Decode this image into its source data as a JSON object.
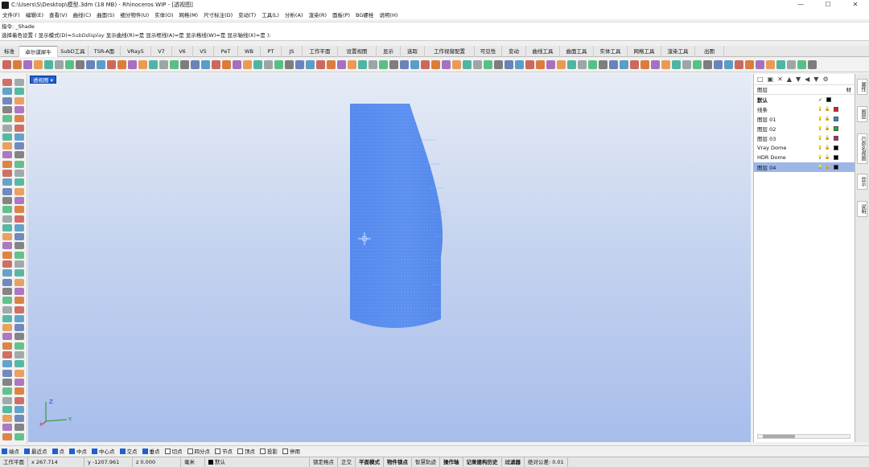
{
  "window": {
    "title": "C:\\Users\\S\\Desktop\\模型.3dm (18 MB) - Rhinoceros WIP - [透视图]",
    "controls": [
      "—",
      "☐",
      "✕"
    ]
  },
  "menu": [
    "文件(F)",
    "编辑(E)",
    "查看(V)",
    "曲线(C)",
    "曲面(S)",
    "细分物件(U)",
    "实体(O)",
    "网格(M)",
    "尺寸标注(D)",
    "变动(T)",
    "工具(L)",
    "分析(A)",
    "渲染(R)",
    "面板(P)",
    "BG螺栓",
    "说明(H)"
  ],
  "command": {
    "line1": "指令: _Shade",
    "line2_prefix": "选择着色设置 ( 显示模式(D)=",
    "line2_mode": "SubDdisplay",
    "line2_rest": " 显示曲线(R)=是  显示框线(A)=是  显示格线(W)=是  显示轴线(X)=是 ):"
  },
  "tabs": [
    "标准",
    "卓尔谟犀牛",
    "SubD工具",
    "TSR-A面",
    "VRay5",
    "V7",
    "V6",
    "V5",
    "PeT",
    "WB",
    "PT",
    "JS",
    "工作平面",
    "设置视图",
    "显示",
    "选取",
    "工作视窗配置",
    "可见性",
    "变动",
    "曲线工具",
    "曲面工具",
    "实体工具",
    "网格工具",
    "渲染工具",
    "出图"
  ],
  "active_tab": "卓尔谟犀牛",
  "viewport": {
    "label": "透视图"
  },
  "axes": {
    "x": "X",
    "y": "Y",
    "z": "Z"
  },
  "layers": {
    "header_name": "图层",
    "header_mat": "材",
    "rows": [
      {
        "name": "默认",
        "check": "✓",
        "color": "#000000",
        "bold": true
      },
      {
        "name": "线条",
        "color": "#e0201e"
      },
      {
        "name": "图层 01",
        "color": "#1e8fe0"
      },
      {
        "name": "图层 02",
        "color": "#1fb31f"
      },
      {
        "name": "图层 03",
        "color": "#d1177a"
      },
      {
        "name": "Vray Dome",
        "color": "#000000"
      },
      {
        "name": "HDR Dome",
        "color": "#000000"
      },
      {
        "name": "图层 04",
        "color": "#000000",
        "selected": true
      }
    ]
  },
  "sidetabs": [
    "属性",
    "图层",
    "已命名视图",
    "显示",
    "说明"
  ],
  "osnaps": [
    {
      "label": "端点",
      "on": true
    },
    {
      "label": "最近点",
      "on": true
    },
    {
      "label": "点",
      "on": true
    },
    {
      "label": "中点",
      "on": true
    },
    {
      "label": "中心点",
      "on": true
    },
    {
      "label": "交点",
      "on": true
    },
    {
      "label": "垂点",
      "on": true
    },
    {
      "label": "切点",
      "on": false
    },
    {
      "label": "四分点",
      "on": false
    },
    {
      "label": "节点",
      "on": false
    },
    {
      "label": "顶点",
      "on": false
    },
    {
      "label": "投影",
      "on": false
    },
    {
      "label": "停用",
      "on": false
    }
  ],
  "status": {
    "plane": "工作平面",
    "x": "x 267.714",
    "y": "y -1207.961",
    "z": "z 0.000",
    "unit": "毫米",
    "layer": "默认",
    "toggles": [
      "锁定格点",
      "正交",
      "平面模式",
      "物件锁点",
      "智慧轨迹",
      "操作轴",
      "记录建构历史",
      "过滤器"
    ],
    "tolerance": "绝对公差: 0.01"
  }
}
